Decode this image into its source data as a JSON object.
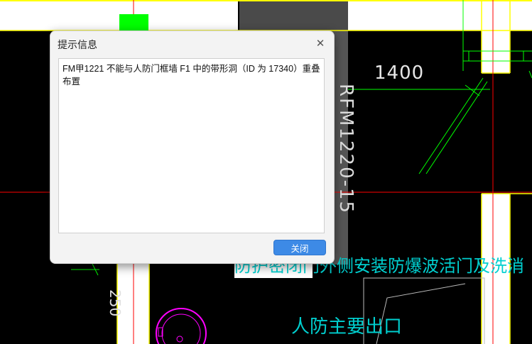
{
  "dialog": {
    "title": "提示信息",
    "close_icon": "close-icon",
    "message": "FM甲1221 不能与人防门框墙 F1 中的带形洞（ID 为 17340）重叠布置",
    "close_button_label": "关闭"
  },
  "drawing": {
    "dimension_text": "1400",
    "door_label": "RFM1220-15",
    "note_text": "防护密闭门外侧安装防爆波活门及洗消",
    "exit_label": "人防主要出口",
    "dimension2_text": "250"
  },
  "colors": {
    "background": "#000000",
    "wall_yellow": "#ffff00",
    "axis_red": "#ff0000",
    "green": "#00ff00",
    "cyan": "#00cfcf",
    "magenta": "#ff00ff",
    "accent": "#3d8ae6"
  }
}
